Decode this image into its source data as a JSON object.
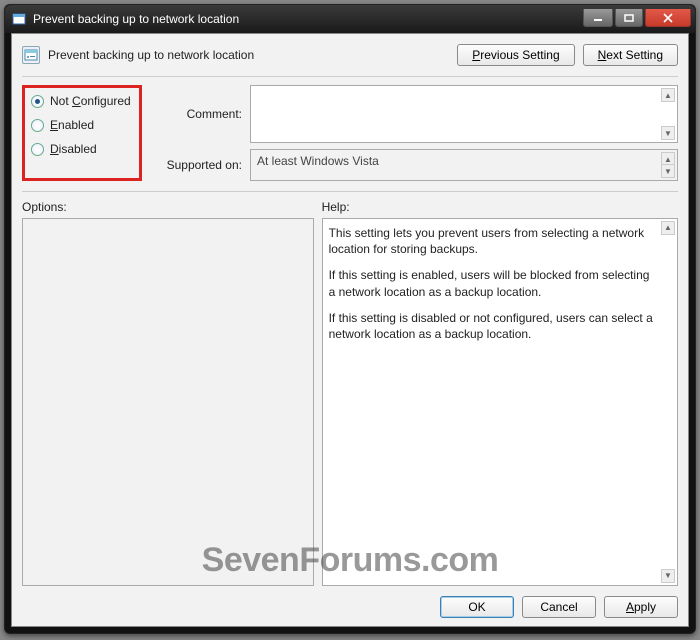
{
  "window": {
    "title": "Prevent backing up to network location"
  },
  "header": {
    "policy_name": "Prevent backing up to network location",
    "previous_label": "Previous Setting",
    "previous_underline": "P",
    "next_label": "Next Setting",
    "next_underline": "N"
  },
  "radios": {
    "not_configured": "Not Configured",
    "not_configured_ul": "C",
    "enabled": "Enabled",
    "enabled_ul": "E",
    "disabled": "Disabled",
    "disabled_ul": "D",
    "selected": "not_configured"
  },
  "fields": {
    "comment_label": "Comment:",
    "comment_value": "",
    "supported_label": "Supported on:",
    "supported_value": "At least Windows Vista"
  },
  "panels": {
    "options_label": "Options:",
    "help_label": "Help:",
    "help_p1": "This setting lets you prevent users from selecting a network location for storing backups.",
    "help_p2": "If this setting is enabled, users will be blocked from selecting a network location as a backup location.",
    "help_p3": "If this setting is disabled or not configured, users can select a network location as a backup location."
  },
  "buttons": {
    "ok": "OK",
    "cancel": "Cancel",
    "apply": "Apply",
    "apply_ul": "A"
  },
  "watermark": "SevenForums.com"
}
